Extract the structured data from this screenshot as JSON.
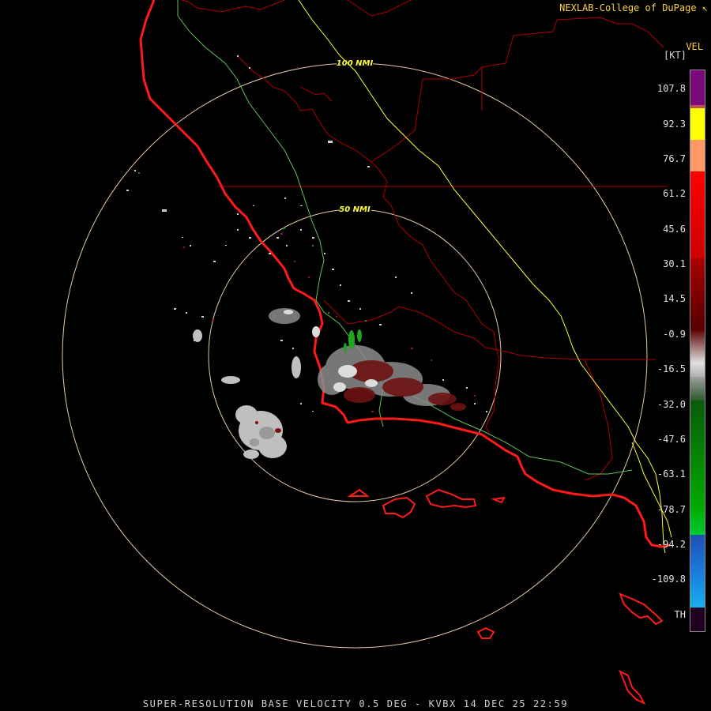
{
  "header": {
    "credit": "NEXLAB-College of DuPage ↖"
  },
  "footer": {
    "caption": "SUPER-RESOLUTION BASE VELOCITY 0.5 DEG - KVBX 14 DEC 25 22:59"
  },
  "rings": {
    "inner": "50 NMI",
    "outer": "100 NMI"
  },
  "legend": {
    "title": "VEL",
    "unit": "[KT]",
    "labels": [
      "107.8",
      "92.3",
      "76.7",
      "61.2",
      "45.6",
      "30.1",
      "14.5",
      "-0.9",
      "-16.5",
      "-32.0",
      "-47.6",
      "-63.1",
      "-78.7",
      "-94.2",
      "-109.8",
      "TH"
    ]
  },
  "colors": {
    "coastline": "#ff1a1a",
    "county": "#b00000",
    "highway": "#ffff33",
    "road": "#5fbf5f",
    "ring": "#e8c9a6",
    "ring_label": "#ffff33"
  }
}
